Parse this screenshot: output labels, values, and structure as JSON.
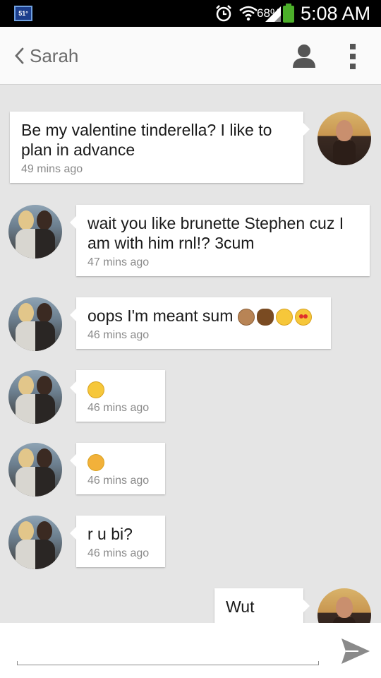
{
  "status_bar": {
    "badge": "51°",
    "battery_percent": "68%",
    "battery_level": 0.68,
    "time": "5:08 AM",
    "icons": [
      "alarm-icon",
      "wifi-icon",
      "signal-icon",
      "battery-icon"
    ]
  },
  "header": {
    "back_icon": "chevron-left-icon",
    "contact_name": "Sarah",
    "contact_icon": "person-icon",
    "menu_icon": "overflow-menu-icon"
  },
  "messages": [
    {
      "from": "me",
      "text": "Be my valentine tinderella? I like to plan in advance",
      "time": "49 mins ago"
    },
    {
      "from": "Sarah",
      "text": "wait you like brunette Stephen cuz I am with him rnl!? 3cum",
      "time": "47 mins ago"
    },
    {
      "from": "Sarah",
      "text": "oops I'm meant sum",
      "emojis": [
        "monkey-emoji",
        "poop-emoji",
        "kiss-emoji",
        "heart-eyes-emoji"
      ],
      "time": "46 mins ago"
    },
    {
      "from": "Sarah",
      "text": "",
      "emojis": [
        "kiss-emoji"
      ],
      "time": "46 mins ago"
    },
    {
      "from": "Sarah",
      "text": "",
      "emojis": [
        "sad-emoji"
      ],
      "time": "46 mins ago"
    },
    {
      "from": "Sarah",
      "text": "r u bi?",
      "time": "46 mins ago"
    },
    {
      "from": "me",
      "text": "Wut",
      "time": ""
    }
  ],
  "compose": {
    "value": "",
    "placeholder": "",
    "send_icon": "send-icon"
  },
  "colors": {
    "background": "#e5e5e5",
    "bubble": "#ffffff",
    "status_bar": "#000000",
    "battery": "#4caf2a"
  }
}
